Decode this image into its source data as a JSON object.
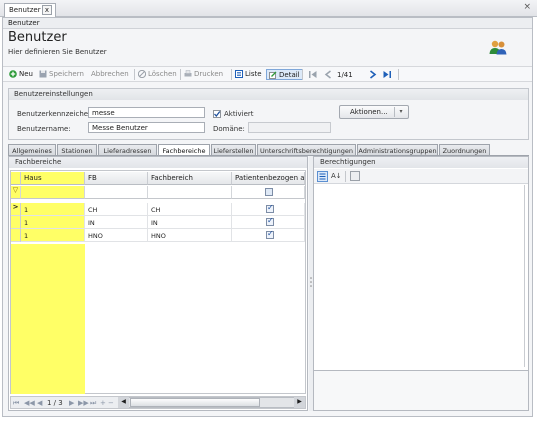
{
  "tab": {
    "label": "Benutzer",
    "close_symbol": "x"
  },
  "window": {
    "close_symbol": "×"
  },
  "breadcrumb": "Benutzer",
  "header": {
    "title": "Benutzer",
    "subtitle": "Hier definieren Sie Benutzer"
  },
  "toolbar": {
    "new": "Neu",
    "save": "Speichern",
    "cancel": "Abbrechen",
    "delete": "Löschen",
    "print": "Drucken",
    "list": "Liste",
    "detail": "Detail",
    "record_position": "1/41"
  },
  "settings": {
    "header": "Benutzereinstellungen",
    "abbrev_label": "Benutzerkennzeichen:",
    "abbrev_value": "messe",
    "active_label": "Aktiviert",
    "active_checked": true,
    "name_label": "Benutzername:",
    "name_value": "Messe Benutzer",
    "domain_label": "Domäne:",
    "domain_value": "",
    "actions_label": "Aktionen...",
    "actions_arrow": "▾"
  },
  "main_tabs": [
    "Allgemeines",
    "Stationen",
    "Lieferadressen",
    "Fachbereiche",
    "Lieferstellen",
    "Unterschriftsberechtigungen",
    "Administrationsgruppen",
    "Zuordnungen"
  ],
  "active_tab": "Fachbereiche",
  "left_panel": {
    "header": "Fachbereiche",
    "columns": [
      "Haus",
      "FB",
      "Fachbereich",
      "Patientenbezogen a..."
    ],
    "rows": [
      {
        "haus": "1",
        "fb": "CH",
        "fachbereich": "CH",
        "patient": true
      },
      {
        "haus": "1",
        "fb": "IN",
        "fachbereich": "IN",
        "patient": true
      },
      {
        "haus": "1",
        "fb": "HNO",
        "fachbereich": "HNO",
        "patient": true
      }
    ],
    "navigator": {
      "page": "1 / 3"
    },
    "filter_symbol": "▽",
    "current_row_symbol": ">"
  },
  "right_panel": {
    "header": "Berechtigungen",
    "sort_label": "A↓"
  },
  "colors": {
    "highlight": "#ffff66",
    "accent_blue": "#1e5fb8",
    "green": "#2e9b3a"
  }
}
